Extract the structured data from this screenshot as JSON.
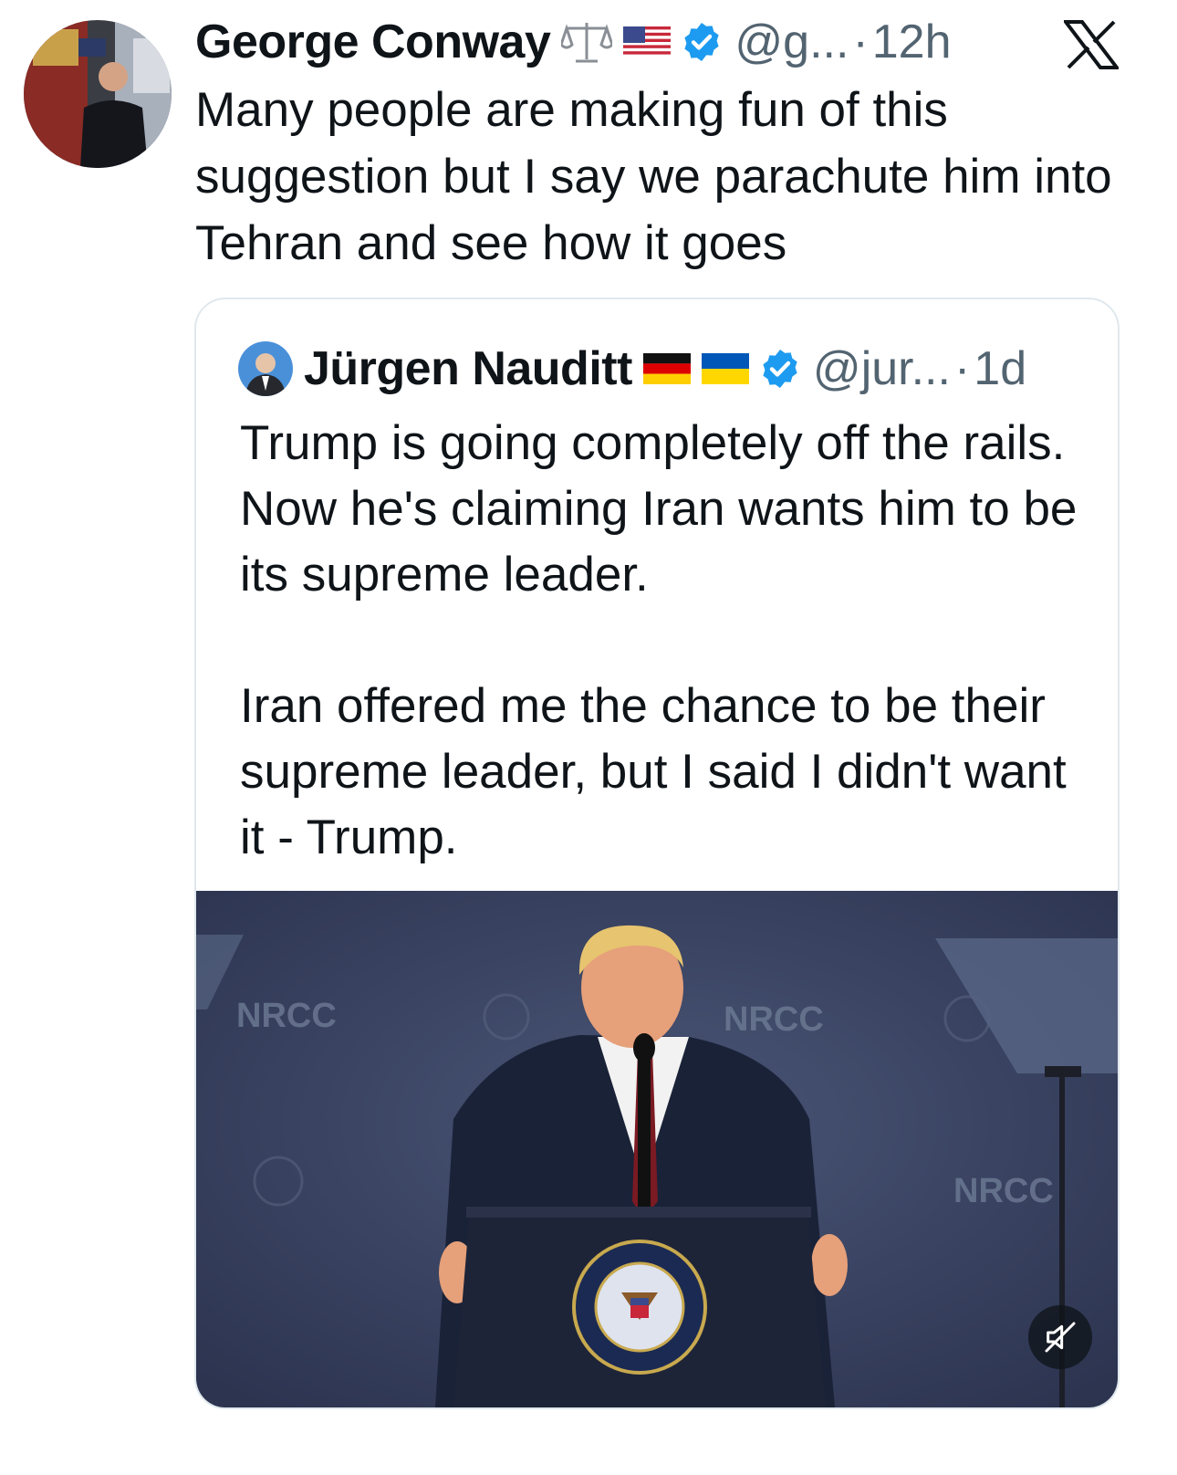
{
  "tweet": {
    "author_name": "George Conway",
    "emoji_icons": [
      "scales-icon",
      "us-flag-icon"
    ],
    "handle": "@g...",
    "separator": "·",
    "time": "12h",
    "text": "Many people are making fun of this suggestion but I say we parachute him into Tehran and see how it goes"
  },
  "quoted_tweet": {
    "author_name": "Jürgen Nauditt",
    "emoji_icons": [
      "german-flag-icon",
      "ukraine-flag-icon"
    ],
    "handle": "@jur...",
    "separator": "·",
    "time": "1d",
    "text": "Trump is going completely off the rails. Now he's claiming Iran wants him to be its supreme leader.\n\nIran offered me the chance to be their supreme leader, but I said I didn't want it - Trump.",
    "media": {
      "type": "video",
      "backdrop_text": [
        "NRCC",
        "NRCC",
        "NRCC"
      ],
      "seal_text": "SEAL OF THE PRESIDENT OF THE UNITED STATES",
      "mute_icon": "muted-speaker-icon"
    }
  },
  "platform_icon": "x-logo-icon",
  "colors": {
    "text": "#0f1419",
    "secondary_text": "#536471",
    "verified_blue": "#1d9bf0",
    "quote_border": "#e1e8ed",
    "video_backdrop": "#3b4360"
  }
}
